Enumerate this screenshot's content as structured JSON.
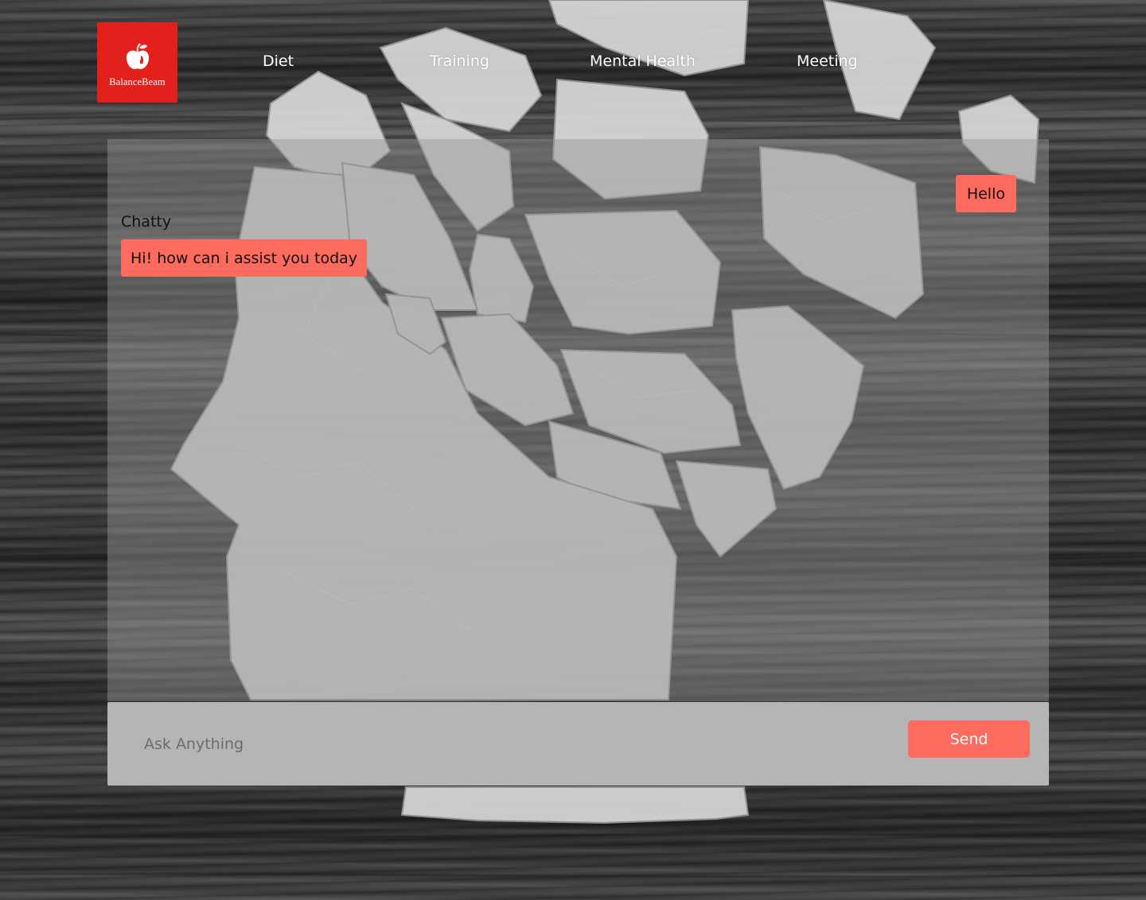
{
  "brand": {
    "name": "BalanceBeam",
    "logo_icon": "apple-icon",
    "color": "#e2211c"
  },
  "nav": {
    "items": [
      {
        "label": "Diet"
      },
      {
        "label": "Training"
      },
      {
        "label": "Mental Health"
      },
      {
        "label": "Meeting"
      }
    ]
  },
  "chat": {
    "assistant_name": "Chatty",
    "messages": [
      {
        "sender": "user",
        "text": "Hello"
      },
      {
        "sender": "assistant",
        "text": "Hi! how can i assist you today"
      }
    ],
    "bubble_color": "#fc6b5e"
  },
  "composer": {
    "placeholder": "Ask Anything",
    "value": "",
    "send_label": "Send"
  }
}
